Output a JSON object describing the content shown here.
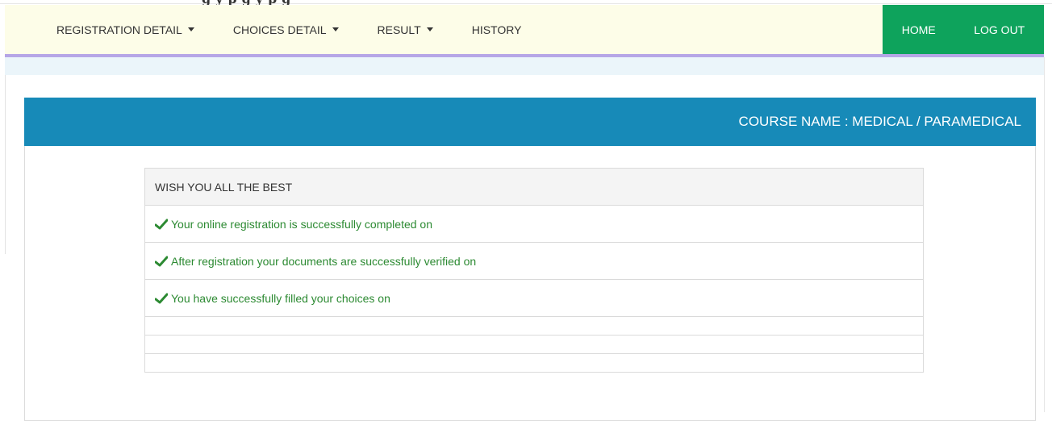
{
  "top_strip": {
    "partial_text": "g            y                                        p g            y           p g"
  },
  "navbar": {
    "left_items": [
      {
        "label": "REGISTRATION DETAIL",
        "dropdown": true
      },
      {
        "label": "CHOICES DETAIL",
        "dropdown": true
      },
      {
        "label": "RESULT",
        "dropdown": true
      },
      {
        "label": "HISTORY",
        "dropdown": false
      }
    ],
    "right_items": [
      {
        "label": "HOME"
      },
      {
        "label": "LOG OUT"
      }
    ],
    "colors": {
      "bg": "#fdfde8",
      "right_bg": "#0ea35c",
      "underline": "#b6a6e6"
    }
  },
  "panel": {
    "title": "COURSE NAME : MEDICAL / PARAMEDICAL",
    "header_color": "#178ab8",
    "list_header": "WISH YOU ALL THE BEST",
    "status_items": [
      {
        "icon": "check-icon",
        "text": "Your online registration is successfully completed on"
      },
      {
        "icon": "check-icon",
        "text": "After registration your documents are successfully verified on"
      },
      {
        "icon": "check-icon",
        "text": "You have successfully filled your choices on"
      }
    ],
    "status_color": "#2c8a32"
  }
}
